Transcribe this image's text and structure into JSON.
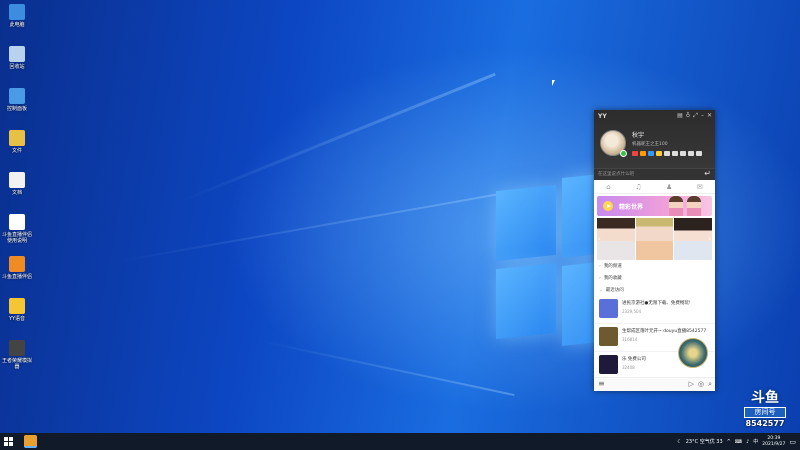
{
  "desktop": {
    "icons": [
      {
        "label": "此电脑",
        "icon": "computer-icon",
        "color": "#3c8de0"
      },
      {
        "label": "回收站",
        "icon": "recycle-bin-icon",
        "color": "#b9d3ef"
      },
      {
        "label": "控制面板",
        "icon": "control-panel-icon",
        "color": "#4a9be6"
      },
      {
        "label": "文件",
        "icon": "folder-icon",
        "color": "#e9c046"
      },
      {
        "label": "文档",
        "icon": "document-icon",
        "color": "#f2f2f2"
      },
      {
        "label": "斗鱼直播伴侣使用说明",
        "icon": "text-file-icon",
        "color": "#ffffff"
      },
      {
        "label": "斗鱼直播伴侣",
        "icon": "douyu-app-icon",
        "color": "#f08a24"
      },
      {
        "label": "YY语音",
        "icon": "yy-app-icon",
        "color": "#f6c533"
      },
      {
        "label": "王者荣耀模拟器",
        "icon": "game-app-icon",
        "color": "#444444"
      }
    ]
  },
  "yy": {
    "brand": "YY",
    "controls": [
      "▤",
      "♁",
      "⤢",
      "–",
      "✕"
    ],
    "user": {
      "name": "秋宇",
      "signature": "机器昵王之王100",
      "status_placeholder": "在这里说点什么吧"
    },
    "tabs": [
      "⌂",
      "♫",
      "♟",
      "✉"
    ],
    "banner_text": "精彩世界",
    "folders": [
      "我的频道",
      "我的收藏",
      "最近访问"
    ],
    "recent": [
      {
        "title": "进民京游社●无限下载、免费畅玩!",
        "meta": "2329,504",
        "color": "#5a6fd8"
      },
      {
        "title": "生帮成区落叶元开~ douyu直播8542577",
        "meta": "316814",
        "color": "#6e5a30"
      },
      {
        "title": "乐 免费公司",
        "meta": "32408",
        "color": "#201a3a"
      }
    ]
  },
  "watermark": {
    "logo": "斗鱼",
    "room_label": "房间号",
    "room_number": "8542577"
  },
  "taskbar": {
    "weather": "23°C 空气优 33",
    "time": "20:39",
    "date": "2021/9/27",
    "tray_icons": [
      "^",
      "⌨",
      "♪",
      "中"
    ]
  },
  "colors": {
    "accent": "#1d5fbf",
    "taskbar": "#101a28"
  }
}
